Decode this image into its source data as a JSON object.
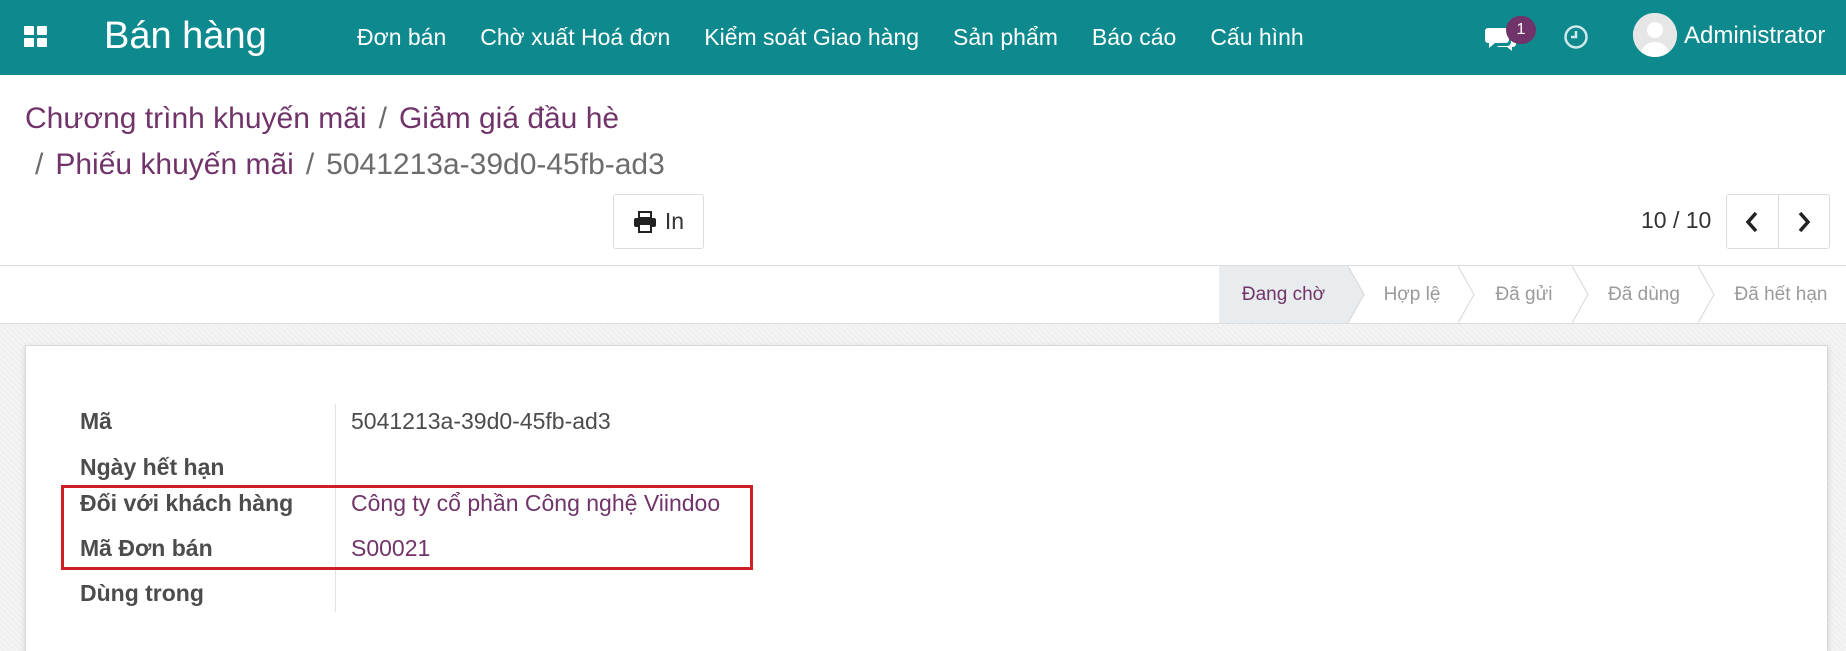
{
  "navbar": {
    "app_name": "Bán hàng",
    "menu": [
      "Đơn bán",
      "Chờ xuất Hoá đơn",
      "Kiểm soát Giao hàng",
      "Sản phẩm",
      "Báo cáo",
      "Cấu hình"
    ],
    "chat_badge": "1",
    "user_name": "Administrator",
    "icons": [
      "apps-grid-icon",
      "chat-icon",
      "clock-icon"
    ]
  },
  "breadcrumb": {
    "items": [
      "Chương trình khuyến mãi",
      "Giảm giá đầu hè",
      "Phiếu khuyến mãi"
    ],
    "current": "5041213a-39d0-45fb-ad3",
    "separator": "/"
  },
  "toolbar": {
    "print_label": "In",
    "pager_value": "10 / 10"
  },
  "statusbar": {
    "stages": [
      "Đang chờ",
      "Hợp lệ",
      "Đã gửi",
      "Đã dùng",
      "Đã hết hạn"
    ],
    "active": "Đang chờ"
  },
  "form": {
    "fields": [
      {
        "label": "Mã",
        "value": "5041213a-39d0-45fb-ad3"
      },
      {
        "label": "Ngày hết hạn",
        "value": ""
      },
      {
        "label": "Đối với khách hàng",
        "value": "Công ty cổ phần Công nghệ Viindoo"
      },
      {
        "label": "Mã Đơn bán",
        "value": "S00021"
      },
      {
        "label": "Dùng trong",
        "value": ""
      }
    ]
  },
  "colors": {
    "navbar": "#0e8a8f",
    "link": "#71346a",
    "highlight": "#d01e26",
    "active_stage_bg": "#e9ecef"
  }
}
